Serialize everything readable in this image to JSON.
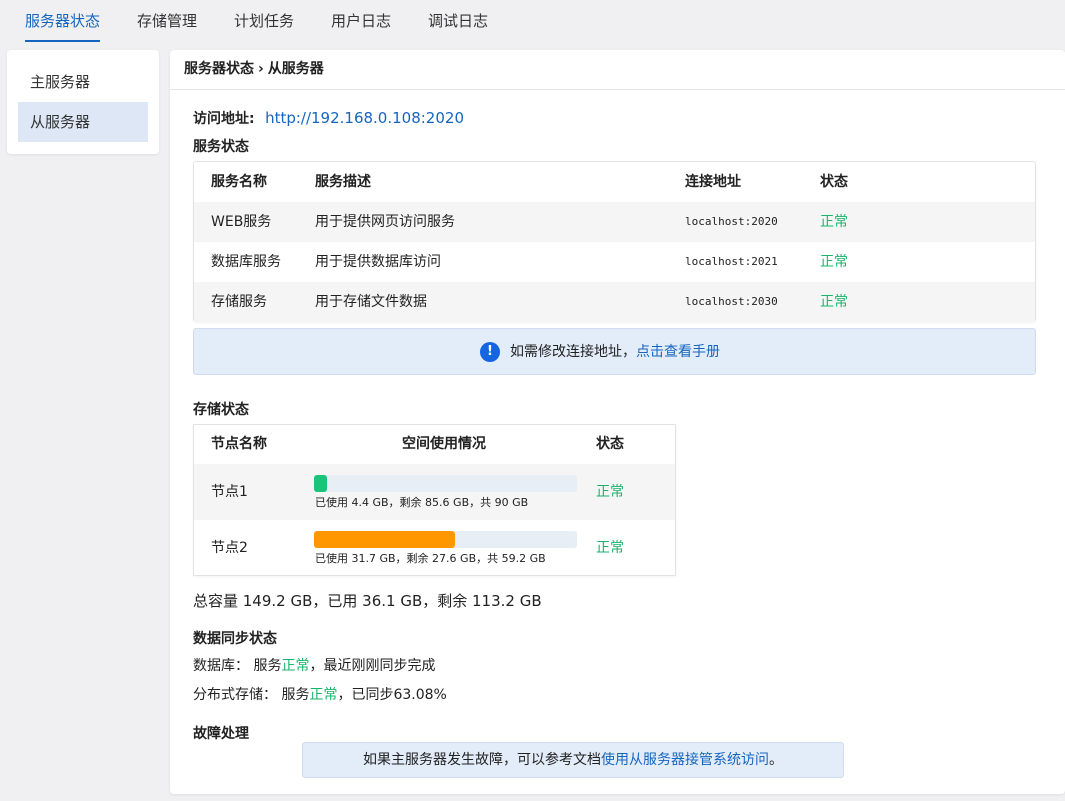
{
  "topnav": {
    "tabs": [
      {
        "label": "服务器状态",
        "active": true
      },
      {
        "label": "存储管理"
      },
      {
        "label": "计划任务"
      },
      {
        "label": "用户日志"
      },
      {
        "label": "调试日志"
      }
    ]
  },
  "sidebar": {
    "items": [
      {
        "label": "主服务器"
      },
      {
        "label": "从服务器",
        "active": true
      }
    ]
  },
  "breadcrumb": {
    "parent": "服务器状态",
    "separator": "›",
    "current": "从服务器"
  },
  "access": {
    "label": "访问地址:",
    "url": "http://192.168.0.108:2020"
  },
  "services": {
    "title": "服务状态",
    "headers": [
      "服务名称",
      "服务描述",
      "连接地址",
      "状态"
    ],
    "rows": [
      {
        "name": "WEB服务",
        "desc": "用于提供网页访问服务",
        "addr": "localhost:2020",
        "status": "正常"
      },
      {
        "name": "数据库服务",
        "desc": "用于提供数据库访问",
        "addr": "localhost:2021",
        "status": "正常"
      },
      {
        "name": "存储服务",
        "desc": "用于存储文件数据",
        "addr": "localhost:2030",
        "status": "正常"
      }
    ]
  },
  "notice": {
    "icon": "info-icon",
    "text": "如需修改连接地址，",
    "link": "点击查看手册"
  },
  "storage": {
    "title": "存储状态",
    "headers": [
      "节点名称",
      "空间使用情况",
      "状态"
    ],
    "nodes": [
      {
        "name": "节点1",
        "used_ratio": 0.049,
        "color": "#18c47a",
        "caption": "已使用 4.4 GB，剩余 85.6 GB，共 90 GB",
        "status": "正常"
      },
      {
        "name": "节点2",
        "used_ratio": 0.535,
        "color": "#ff9800",
        "caption": "已使用 31.7 GB，剩余 27.6 GB，共 59.2 GB",
        "status": "正常"
      }
    ],
    "summary": "总容量 149.2 GB，已用 36.1 GB，剩余 113.2 GB"
  },
  "sync": {
    "title": "数据同步状态",
    "db": {
      "prefix": "数据库：  服务",
      "status": "正常",
      "suffix": "，最近刚刚同步完成"
    },
    "dist": {
      "prefix": "分布式存储：  服务",
      "status": "正常",
      "suffix": "，已同步63.08%"
    }
  },
  "fault": {
    "title": "故障处理",
    "text": "如果主服务器发生故障，可以参考文档",
    "link": "使用从服务器接管系统访问",
    "end": "。"
  },
  "colors": {
    "accent": "#1565c0",
    "ok": "#19b46b"
  }
}
